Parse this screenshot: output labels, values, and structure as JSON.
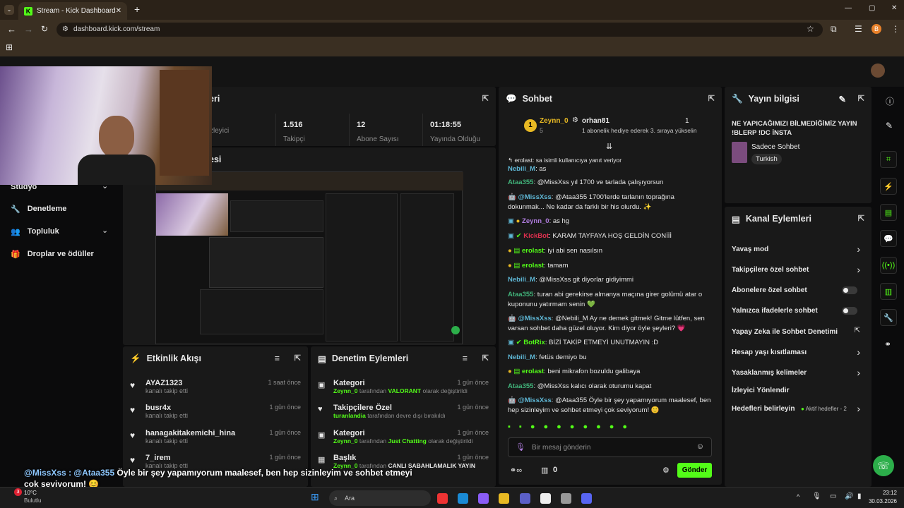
{
  "browser": {
    "tab_title": "Stream - Kick Dashboard",
    "url": "dashboard.kick.com/stream",
    "profile_initial": "B"
  },
  "left_nav": {
    "items": [
      "Stüdyo",
      "Denetleme",
      "Topluluk",
      "Droplar ve ödüller"
    ]
  },
  "partial_titles": {
    "stats": "eri",
    "preview": "esi"
  },
  "stats": [
    {
      "value": "",
      "label": "zleyici"
    },
    {
      "value": "1.516",
      "label": "Takipçi"
    },
    {
      "value": "12",
      "label": "Abone Sayısı"
    },
    {
      "value": "01:18:55",
      "label": "Yayında Olduğu"
    }
  ],
  "activity": {
    "title": "Etkinlik Akışı",
    "items": [
      {
        "user": "AYAZ1323",
        "text": "kanalı takip etti",
        "time": "1 saat önce"
      },
      {
        "user": "busr4x",
        "text": "kanalı takip etti",
        "time": "1 gün önce"
      },
      {
        "user": "hanagakitakemichi_hina",
        "text": "kanalı takip etti",
        "time": "1 gün önce"
      },
      {
        "user": "7_irem",
        "text": "kanalı takip etti",
        "time": "1 gün önce"
      }
    ]
  },
  "moderation": {
    "title": "Denetim Eylemleri",
    "items": [
      {
        "title": "Kategori",
        "user": "Zeynn_0",
        "mid": "tarafından",
        "hl": "VALORANT",
        "end": "olarak değiştirildi",
        "time": "1 gün önce"
      },
      {
        "title": "Takipçilere Özel",
        "user": "turanlandia",
        "mid": "tarafından devre dışı bırakıldı",
        "hl": "",
        "end": "",
        "time": "1 gün önce"
      },
      {
        "title": "Kategori",
        "user": "Zeynn_0",
        "mid": "tarafından",
        "hl": "Just Chatting",
        "end": "olarak değiştirildi",
        "time": "1 gün önce"
      },
      {
        "title": "Başlık",
        "user": "Zeynn_0",
        "mid": "tarafından",
        "hl": "CANLI SABAHLAMALIK YAYIN",
        "end": "",
        "time": "1 gün önce"
      }
    ]
  },
  "chat": {
    "title": "Sohbet",
    "leader": {
      "rank": "1",
      "name": "Zeynn_0",
      "count": "5",
      "gifter": "orhan81",
      "gift_count": "1",
      "gift_text": "1 abonelik hediye ederek 3. sıraya yükselin"
    },
    "reply_note": "erolast: sa isimli kullanıcıya yanıt veriyor",
    "messages": [
      {
        "user": "Nebili_M",
        "text": "as"
      },
      {
        "user": "Ataa355",
        "text": "@MissXss yıl 1700 ve tarlada çalışıyorsun"
      },
      {
        "user": "@MissXss",
        "text": "@Ataa355 1700'lerde tarlanın toprağına dokunmak... Ne kadar da farklı bir his olurdu. ✨"
      },
      {
        "user": "Zeynn_0",
        "text": "as hg"
      },
      {
        "user": "KickBot",
        "text": "KARAM TAYFAYA HOŞ GELDİN CONİİİ"
      },
      {
        "user": "erolast",
        "text": "iyi abi sen nasılsın"
      },
      {
        "user": "erolast",
        "text": "tamam"
      },
      {
        "user": "Nebili_M",
        "text": "@MissXss git diyorlar gidiyimmi"
      },
      {
        "user": "Ataa355",
        "text": "turan abi gerekirse almanya maçına girer golümü atar o kuponunu yatırmam senin 💚"
      },
      {
        "user": "@MissXss",
        "text": "@Nebili_M Ay ne demek gitmek! Gitme lütfen, sen varsan sohbet daha güzel oluyor. Kim diyor öyle şeyleri? 💗"
      },
      {
        "user": "BotRix",
        "text": "BİZİ TAKİP ETMEYİ UNUTMAYIN :D"
      },
      {
        "user": "Nebili_M",
        "text": "fetüs demiyo bu"
      },
      {
        "user": "erolast",
        "text": "beni mikrafon bozuldu galibaya"
      },
      {
        "user": "Ataa355",
        "text": "@MissXss kalıcı olarak oturumu kapat"
      },
      {
        "user": "@MissXss",
        "text": "@Ataa355 Öyle bir şey yapamıyorum maalesef, ben hep sizinleyim ve sohbet etmeyi çok seviyorum! 😊"
      }
    ],
    "input_placeholder": "Bir mesaj gönderin",
    "points": "0",
    "send_label": "Gönder"
  },
  "stream_info": {
    "title": "Yayın bilgisi",
    "stream_title": "NE YAPICAĞIMIZI BİLMEDİĞİMİZ YAYIN !BLERP !DC İNSTA",
    "category": "Sadece Sohbet",
    "language": "Turkish"
  },
  "channel_actions": {
    "title": "Kanal Eylemleri",
    "items": [
      {
        "label": "Yavaş mod",
        "control": "chevron"
      },
      {
        "label": "Takipçilere özel sohbet",
        "control": "chevron"
      },
      {
        "label": "Abonelere özel sohbet",
        "control": "toggle"
      },
      {
        "label": "Yalnızca ifadelerle sohbet",
        "control": "toggle"
      },
      {
        "label": "Yapay Zeka ile Sohbet Denetimi",
        "control": "external"
      },
      {
        "label": "Hesap yaşı kısıtlaması",
        "control": "chevron"
      },
      {
        "label": "Yasaklanmış kelimeler",
        "control": "chevron"
      },
      {
        "label": "İzleyici Yönlendir",
        "control": "none"
      },
      {
        "label": "Hedefleri belirleyin",
        "control": "chevron",
        "extra": "Aktif hedefler - 2"
      }
    ]
  },
  "overlay_caption": {
    "mention": "@MissXss : @Ataa355",
    "text": "Öyle bir şey yapamıyorum maalesef, ben hep sizinleyim ve sohbet etmeyi çok seviyorum! 😊"
  },
  "taskbar": {
    "weather_temp": "10°C",
    "weather_text": "Bulutlu",
    "search": "Ara",
    "time": "23:12",
    "date": "30.03.2026",
    "badge": "3"
  },
  "colors": {
    "accent": "#53fc18",
    "panel": "#191919",
    "bg": "#0b0b0c"
  }
}
